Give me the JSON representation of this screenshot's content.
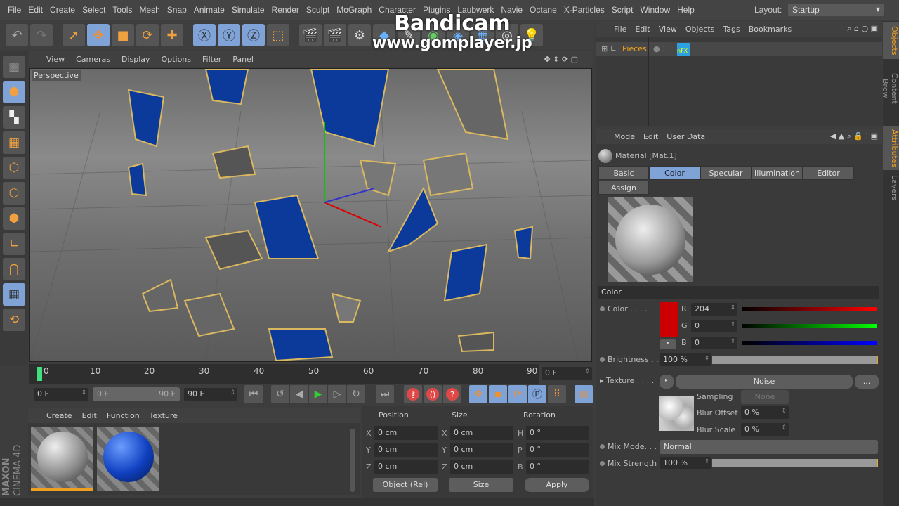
{
  "menu": [
    "File",
    "Edit",
    "Create",
    "Select",
    "Tools",
    "Mesh",
    "Snap",
    "Animate",
    "Simulate",
    "Render",
    "Sculpt",
    "MoGraph",
    "Character",
    "Plugins",
    "Laubwerk",
    "Navie",
    "Octane",
    "X-Particles",
    "Script",
    "Window",
    "Help"
  ],
  "layout": {
    "label": "Layout:",
    "value": "Startup"
  },
  "watermark": {
    "line1": "Bandicam",
    "line2": "www.gomplayer.jp"
  },
  "viewport": {
    "menu": [
      "View",
      "Cameras",
      "Display",
      "Options",
      "Filter",
      "Panel"
    ],
    "label": "Perspective"
  },
  "timeline": {
    "ticks": [
      "0",
      "10",
      "20",
      "30",
      "40",
      "50",
      "60",
      "70",
      "80",
      "90"
    ],
    "current": "0 F",
    "start": "0 F",
    "range_start": "0 F",
    "range_end": "90 F",
    "end": "90 F"
  },
  "material_manager": {
    "menu": [
      "Create",
      "Edit",
      "Function",
      "Texture"
    ],
    "brand1": "MAXON",
    "brand2": "CINEMA 4D"
  },
  "coords": {
    "headers": [
      "Position",
      "Size",
      "Rotation"
    ],
    "rows": [
      {
        "pl": "X",
        "p": "0 cm",
        "sl": "X",
        "s": "0 cm",
        "rl": "H",
        "r": "0 °"
      },
      {
        "pl": "Y",
        "p": "0 cm",
        "sl": "Y",
        "s": "0 cm",
        "rl": "P",
        "r": "0 °"
      },
      {
        "pl": "Z",
        "p": "0 cm",
        "sl": "Z",
        "s": "0 cm",
        "rl": "B",
        "r": "0 °"
      }
    ],
    "mode": "Object (Rel)",
    "size_mode": "Size",
    "apply": "Apply"
  },
  "objects": {
    "menu": [
      "File",
      "Edit",
      "View",
      "Objects",
      "Tags",
      "Bookmarks"
    ],
    "item": "Pieces",
    "tag": "nFX"
  },
  "attributes": {
    "menu": [
      "Mode",
      "Edit",
      "User Data"
    ],
    "title": "Material [Mat.1]",
    "tabs": [
      "Basic",
      "Color",
      "Specular",
      "Illumination",
      "Editor",
      "Assign"
    ],
    "active_tab": "Color",
    "section": "Color",
    "color_label": "Color . . . .",
    "r_label": "R",
    "r": "204",
    "g_label": "G",
    "g": "0",
    "b_label": "B",
    "b": "0",
    "swatch": "#cc0000",
    "brightness_label": "Brightness . .",
    "brightness": "100 %",
    "brightness_value": 100,
    "texture_label": "Texture . . . .",
    "texture": "Noise",
    "more": "...",
    "sampling_label": "Sampling",
    "sampling": "None",
    "blur_offset_label": "Blur Offset",
    "blur_offset": "0 %",
    "blur_scale_label": "Blur Scale",
    "blur_scale": "0 %",
    "mix_mode_label": "Mix Mode. . .",
    "mix_mode": "Normal",
    "mix_strength_label": "Mix Strength",
    "mix_strength": "100 %",
    "mix_strength_value": 100
  },
  "side_tabs": [
    "Objects",
    "Content Brow",
    "Attributes",
    "Layers"
  ]
}
